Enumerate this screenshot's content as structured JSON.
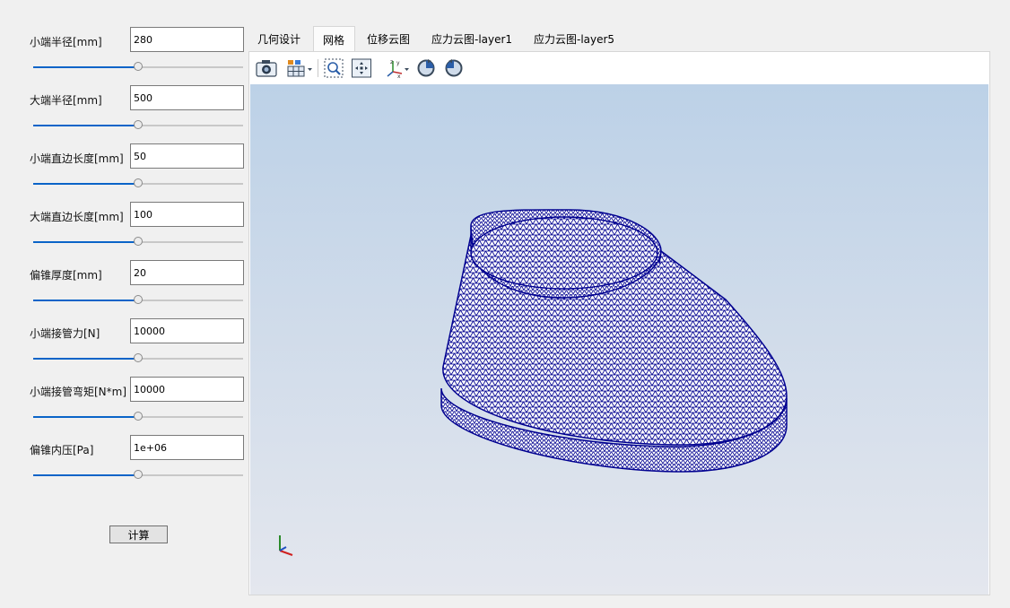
{
  "params": [
    {
      "label": "小端半径[mm]",
      "value": "280",
      "slider_fraction": 0.5
    },
    {
      "label": "大端半径[mm]",
      "value": "500",
      "slider_fraction": 0.5
    },
    {
      "label": "小端直边长度[mm]",
      "value": "50",
      "slider_fraction": 0.5
    },
    {
      "label": "大端直边长度[mm]",
      "value": "100",
      "slider_fraction": 0.5
    },
    {
      "label": "偏锥厚度[mm]",
      "value": "20",
      "slider_fraction": 0.5
    },
    {
      "label": "小端接管力[N]",
      "value": "10000",
      "slider_fraction": 0.5
    },
    {
      "label": "小端接管弯矩[N*m]",
      "value": "10000",
      "slider_fraction": 0.5
    },
    {
      "label": "偏锥内压[Pa]",
      "value": "1e+06",
      "slider_fraction": 0.5
    }
  ],
  "calc_button": "计算",
  "tabs": [
    {
      "label": "几何设计",
      "active": false
    },
    {
      "label": "网格",
      "active": true
    },
    {
      "label": "位移云图",
      "active": false
    },
    {
      "label": "应力云图-layer1",
      "active": false
    },
    {
      "label": "应力云图-layer5",
      "active": false
    }
  ],
  "toolbar": [
    {
      "icon": "camera-icon"
    },
    {
      "icon": "display-mode-icon"
    },
    {
      "icon": "zoom-box-icon"
    },
    {
      "icon": "fit-all-icon"
    },
    {
      "icon": "axes-view-icon"
    },
    {
      "icon": "rotate-cw-icon"
    },
    {
      "icon": "rotate-ccw-icon"
    }
  ],
  "colors": {
    "mesh": "#000090",
    "mesh_fill": "#ffffff",
    "slider_fill": "#0a64c8",
    "background_top": "#bcd1e7",
    "background_bottom": "#e4e7ee"
  }
}
